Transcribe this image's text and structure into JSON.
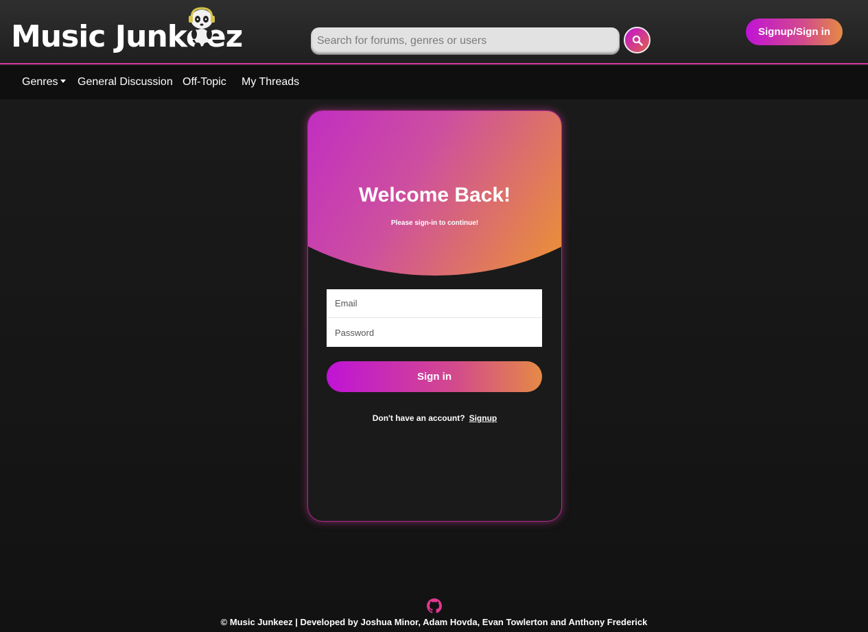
{
  "app": {
    "logo_text": "Music Junkeez"
  },
  "header": {
    "search_placeholder": "Search for forums, genres or users",
    "search_icon": "search-icon",
    "signup_button": "Signup/Sign in"
  },
  "nav": {
    "items": [
      {
        "label": "Genres",
        "dropdown": true
      },
      {
        "label": "General Discussion"
      },
      {
        "label": "Off-Topic"
      },
      {
        "label": "My Threads"
      }
    ]
  },
  "login": {
    "title": "Welcome Back!",
    "subtitle": "Please sign-in to continue!",
    "email_placeholder": "Email",
    "password_placeholder": "Password",
    "signin_button": "Sign in",
    "no_account_text": "Don't have an account?",
    "signup_link": "Signup"
  },
  "footer": {
    "icon": "github-icon",
    "text": "© Music Junkeez | Developed by Joshua Minor, Adam Hovda, Evan Towlerton and Anthony Frederick"
  },
  "colors": {
    "accent_magenta": "#c013d6",
    "accent_pink": "#d63ba3",
    "accent_orange": "#e58a45",
    "background": "#171717"
  }
}
